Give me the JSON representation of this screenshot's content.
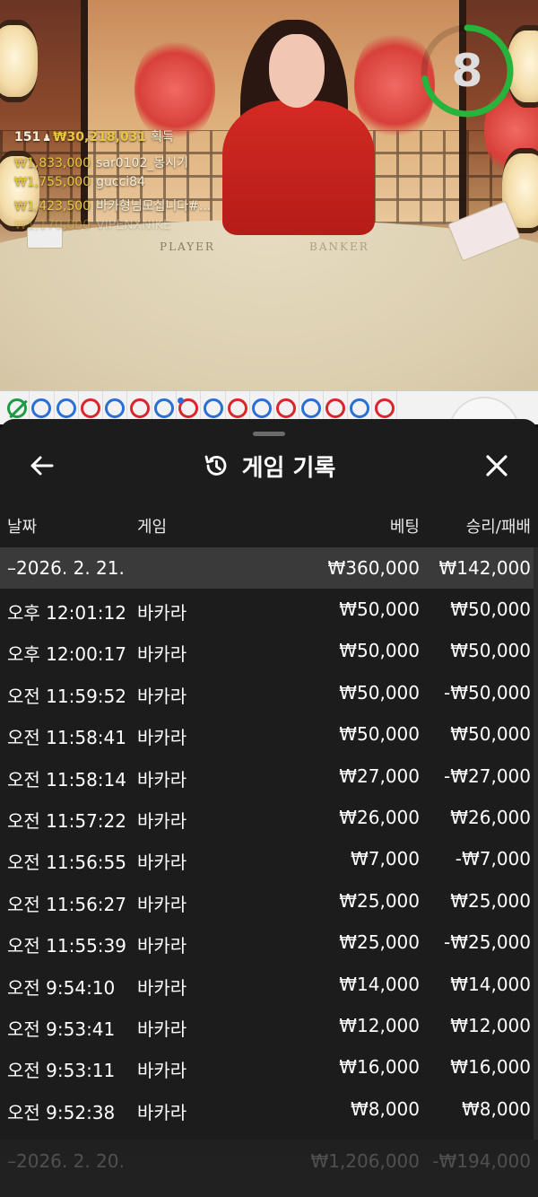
{
  "stream": {
    "table_left_label": "PLAYER",
    "table_right_label": "BANKER"
  },
  "overlay": {
    "winner_count": "151",
    "total_won": "₩30,218,031",
    "earned_label": "획득",
    "winners": [
      {
        "amount": "₩1,833,000",
        "name": "sar0102_몽시기"
      },
      {
        "amount": "₩1,755,000",
        "name": "gucci84"
      },
      {
        "amount": "₩1,423,500",
        "name": "바카형님모십니다#..."
      },
      {
        "amount": "₩1,170,000",
        "name": "VIPENXNIKE"
      }
    ]
  },
  "timer": {
    "seconds": "8",
    "progress": 0.72,
    "color": "#27b43c"
  },
  "road": {
    "cells": [
      "tie",
      "blue",
      "blue",
      "red",
      "blue",
      "red",
      "blue",
      "redDot",
      "blue",
      "red",
      "blue",
      "red",
      "blue",
      "red",
      "blue",
      "red"
    ]
  },
  "panel": {
    "title": "게임 기록",
    "columns": {
      "date": "날짜",
      "game": "게임",
      "bet": "베팅",
      "winloss": "승리/패배"
    },
    "groups": [
      {
        "date": "–2026. 2. 21.",
        "bet": "₩360,000",
        "winloss": "₩142,000",
        "rows": [
          {
            "time": "오후 12:01:12",
            "game": "바카라",
            "bet": "₩50,000",
            "winloss": "₩50,000"
          },
          {
            "time": "오후 12:00:17",
            "game": "바카라",
            "bet": "₩50,000",
            "winloss": "₩50,000"
          },
          {
            "time": "오전 11:59:52",
            "game": "바카라",
            "bet": "₩50,000",
            "winloss": "-₩50,000"
          },
          {
            "time": "오전 11:58:41",
            "game": "바카라",
            "bet": "₩50,000",
            "winloss": "₩50,000"
          },
          {
            "time": "오전 11:58:14",
            "game": "바카라",
            "bet": "₩27,000",
            "winloss": "-₩27,000"
          },
          {
            "time": "오전 11:57:22",
            "game": "바카라",
            "bet": "₩26,000",
            "winloss": "₩26,000"
          },
          {
            "time": "오전 11:56:55",
            "game": "바카라",
            "bet": "₩7,000",
            "winloss": "-₩7,000"
          },
          {
            "time": "오전 11:56:27",
            "game": "바카라",
            "bet": "₩25,000",
            "winloss": "₩25,000"
          },
          {
            "time": "오전 11:55:39",
            "game": "바카라",
            "bet": "₩25,000",
            "winloss": "-₩25,000"
          },
          {
            "time": "오전 9:54:10",
            "game": "바카라",
            "bet": "₩14,000",
            "winloss": "₩14,000"
          },
          {
            "time": "오전 9:53:41",
            "game": "바카라",
            "bet": "₩12,000",
            "winloss": "₩12,000"
          },
          {
            "time": "오전 9:53:11",
            "game": "바카라",
            "bet": "₩16,000",
            "winloss": "₩16,000"
          },
          {
            "time": "오전 9:52:38",
            "game": "바카라",
            "bet": "₩8,000",
            "winloss": "₩8,000"
          }
        ]
      },
      {
        "date": "–2026. 2. 20.",
        "bet": "₩1,206,000",
        "winloss": "-₩194,000",
        "rows": []
      }
    ]
  }
}
